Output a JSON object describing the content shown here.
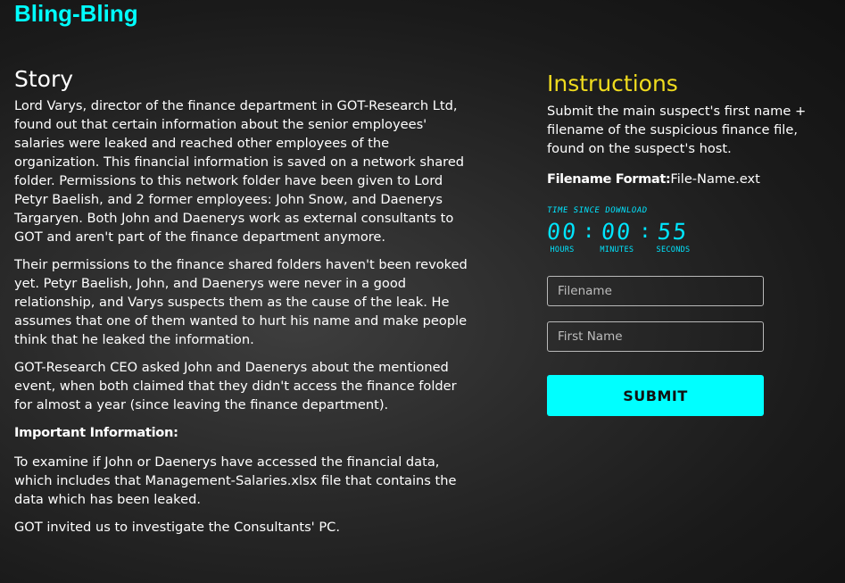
{
  "app": {
    "title": "Bling-Bling"
  },
  "story": {
    "heading": "Story",
    "paragraphs": [
      "Lord Varys, director of the finance department in GOT-Research Ltd, found out that certain information about the senior employees' salaries were leaked and reached other employees of the organization. This financial information is saved on a network shared folder. Permissions to this network folder have been given to Lord Petyr Baelish, and 2 former employees: John Snow, and Daenerys Targaryen. Both John and Daenerys work as external consultants to GOT and aren't part of the finance department anymore.",
      "Their permissions to the finance shared folders haven't been revoked yet. Petyr Baelish, John, and Daenerys were never in a good relationship, and Varys suspects them as the cause of the leak. He assumes that one of them wanted to hurt his name and make people think that he leaked the information.",
      "GOT-Research CEO asked John and Daenerys about the mentioned event, when both claimed that they didn't access the finance folder for almost a year (since leaving the finance department).",
      "Important Information:",
      "To examine if John or Daenerys have accessed the financial data, which includes that Management-Salaries.xlsx file that contains the data which has been leaked.",
      "GOT invited us to investigate the Consultants' PC."
    ]
  },
  "instructions": {
    "heading": "Instructions",
    "description": "Submit the main suspect's first name + filename of the suspicious finance file, found on the suspect's host.",
    "format_label": "Filename Format:",
    "format_value": "File-Name.ext"
  },
  "timer": {
    "title": "Time Since Download",
    "hours": "00",
    "minutes": "00",
    "seconds": "55",
    "hours_label": "HOURS",
    "minutes_label": "MINUTES",
    "seconds_label": "SECONDS",
    "separator": ":"
  },
  "form": {
    "filename_placeholder": "Filename",
    "firstname_placeholder": "First Name",
    "submit_label": "SUBMIT"
  },
  "colors": {
    "accent_cyan": "#00ffff",
    "instructions_yellow": "#f0dc1e",
    "timer_cyan": "#00e5ff"
  }
}
